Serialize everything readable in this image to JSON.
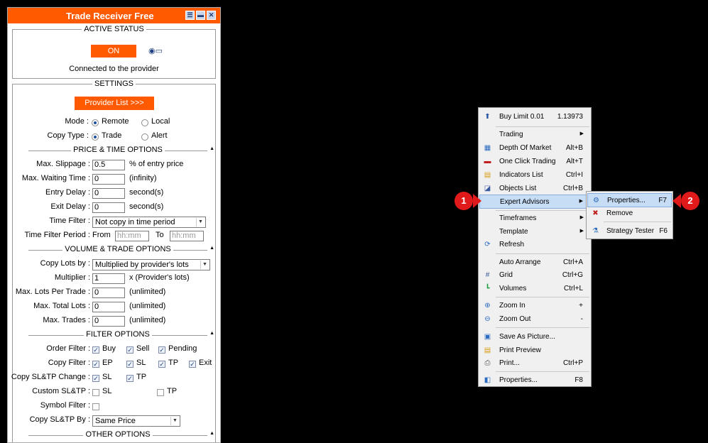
{
  "panel": {
    "title": "Trade Receiver Free",
    "active_status": {
      "heading": "ACTIVE STATUS",
      "on_label": "ON",
      "connection_text": "Connected to the provider"
    },
    "settings": {
      "heading": "SETTINGS",
      "provider_button": "Provider List >>>",
      "mode_label": "Mode :",
      "mode_options": [
        "Remote",
        "Local"
      ],
      "mode_selected": "Remote",
      "copy_type_label": "Copy Type :",
      "copy_type_options": [
        "Trade",
        "Alert"
      ],
      "copy_type_selected": "Trade"
    },
    "price_time": {
      "heading": "PRICE & TIME OPTIONS",
      "max_slippage_label": "Max. Slippage :",
      "max_slippage_value": "0.5",
      "max_slippage_unit": "% of entry price",
      "max_waiting_label": "Max. Waiting Time :",
      "max_waiting_value": "0",
      "max_waiting_unit": "(infinity)",
      "entry_delay_label": "Entry Delay :",
      "entry_delay_value": "0",
      "entry_delay_unit": "second(s)",
      "exit_delay_label": "Exit Delay :",
      "exit_delay_value": "0",
      "exit_delay_unit": "second(s)",
      "time_filter_label": "Time Filter :",
      "time_filter_value": "Not copy in time period",
      "time_filter_period_label": "Time Filter Period :",
      "from_label": "From",
      "from_placeholder": "hh:mm",
      "to_label": "To",
      "to_placeholder": "hh:mm"
    },
    "volume_trade": {
      "heading": "VOLUME & TRADE OPTIONS",
      "copy_lots_label": "Copy Lots by :",
      "copy_lots_value": "Multiplied by provider's lots",
      "multiplier_label": "Multiplier :",
      "multiplier_value": "1",
      "multiplier_unit": "x (Provider's lots)",
      "max_lots_label": "Max. Lots Per Trade :",
      "max_lots_value": "0",
      "max_lots_unit": "(unlimited)",
      "max_total_label": "Max. Total Lots :",
      "max_total_value": "0",
      "max_total_unit": "(unlimited)",
      "max_trades_label": "Max. Trades :",
      "max_trades_value": "0",
      "max_trades_unit": "(unlimited)"
    },
    "filter": {
      "heading": "FILTER OPTIONS",
      "order_filter_label": "Order Filter :",
      "order_filter_options": [
        {
          "label": "Buy",
          "checked": true
        },
        {
          "label": "Sell",
          "checked": true
        },
        {
          "label": "Pending",
          "checked": true
        }
      ],
      "copy_filter_label": "Copy Filter :",
      "copy_filter_options": [
        {
          "label": "EP",
          "checked": true
        },
        {
          "label": "SL",
          "checked": true
        },
        {
          "label": "TP",
          "checked": true
        },
        {
          "label": "Exit",
          "checked": true
        }
      ],
      "sltp_change_label": "Copy SL&TP Change :",
      "sltp_change_options": [
        {
          "label": "SL",
          "checked": true
        },
        {
          "label": "TP",
          "checked": true
        }
      ],
      "custom_sltp_label": "Custom SL&TP :",
      "custom_sltp_options": [
        {
          "label": "SL",
          "checked": false
        },
        {
          "label": "TP",
          "checked": false
        }
      ],
      "symbol_filter_label": "Symbol Filter :",
      "symbol_filter_checked": false,
      "copy_sltp_by_label": "Copy SL&TP By :",
      "copy_sltp_by_value": "Same Price"
    },
    "other": {
      "heading": "OTHER OPTIONS"
    }
  },
  "menu": {
    "items": [
      {
        "label": "Buy Limit 0.01",
        "shortcut": "1.13973",
        "icon": "buy-limit-icon"
      },
      {
        "label": "Trading",
        "submenu": true
      },
      {
        "label": "Depth Of Market",
        "shortcut": "Alt+B",
        "icon": "depth-of-market-icon"
      },
      {
        "label": "One Click Trading",
        "shortcut": "Alt+T",
        "icon": "one-click-trading-icon"
      },
      {
        "label": "Indicators List",
        "shortcut": "Ctrl+I",
        "icon": "indicators-list-icon"
      },
      {
        "label": "Objects List",
        "shortcut": "Ctrl+B",
        "icon": "objects-list-icon"
      },
      {
        "label": "Expert Advisors",
        "submenu": true
      },
      {
        "label": "Timeframes",
        "submenu": true
      },
      {
        "label": "Template",
        "submenu": true
      },
      {
        "label": "Refresh",
        "icon": "refresh-icon"
      },
      {
        "label": "Auto Arrange",
        "shortcut": "Ctrl+A"
      },
      {
        "label": "Grid",
        "shortcut": "Ctrl+G",
        "icon": "grid-icon"
      },
      {
        "label": "Volumes",
        "shortcut": "Ctrl+L",
        "icon": "volumes-icon"
      },
      {
        "label": "Zoom In",
        "shortcut": "+",
        "icon": "zoom-in-icon"
      },
      {
        "label": "Zoom Out",
        "shortcut": "-",
        "icon": "zoom-out-icon"
      },
      {
        "label": "Save As Picture...",
        "icon": "save-picture-icon"
      },
      {
        "label": "Print Preview",
        "icon": "print-preview-icon"
      },
      {
        "label": "Print...",
        "shortcut": "Ctrl+P",
        "icon": "print-icon"
      },
      {
        "label": "Properties...",
        "shortcut": "F8",
        "icon": "properties-icon"
      }
    ],
    "highlighted": "Expert Advisors"
  },
  "submenu": {
    "items": [
      {
        "label": "Properties...",
        "shortcut": "F7",
        "icon": "ea-properties-icon"
      },
      {
        "label": "Remove",
        "icon": "ea-remove-icon"
      },
      {
        "label": "Strategy Tester",
        "shortcut": "F6",
        "icon": "strategy-tester-icon"
      }
    ]
  },
  "badges": {
    "first": "1",
    "second": "2"
  },
  "colors": {
    "accent": "#ff5a00",
    "badge": "#e01a1a",
    "menu_highlight": "#c7dcf5"
  }
}
